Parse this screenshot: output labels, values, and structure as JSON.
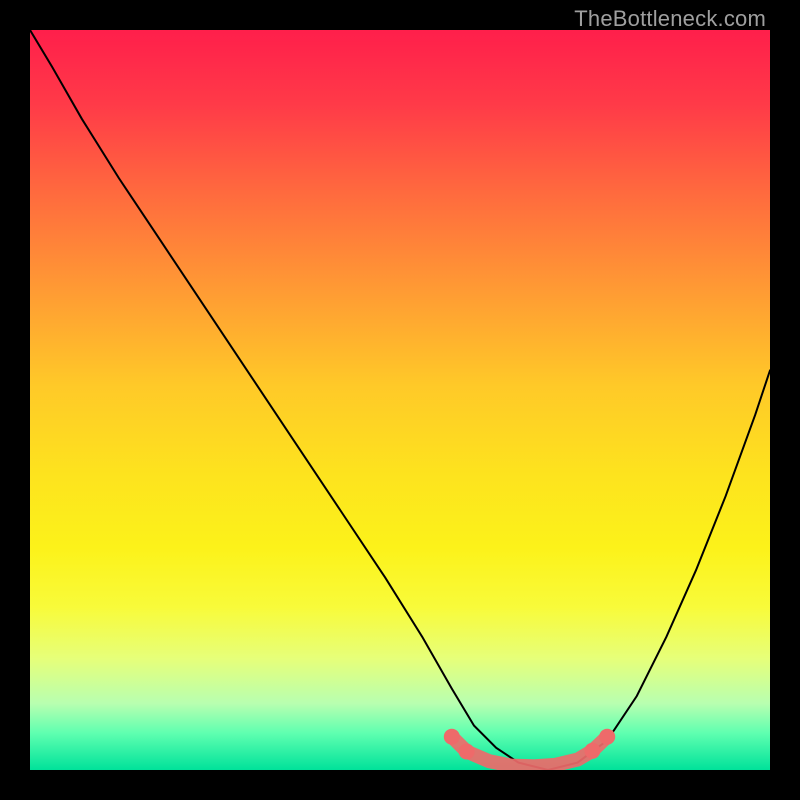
{
  "watermark": "TheBottleneck.com",
  "chart_data": {
    "type": "line",
    "title": "",
    "xlabel": "",
    "ylabel": "",
    "xlim": [
      0,
      100
    ],
    "ylim": [
      0,
      100
    ],
    "grid": false,
    "series": [
      {
        "name": "bottleneck-curve",
        "color": "#000000",
        "x": [
          0,
          3,
          7,
          12,
          18,
          24,
          30,
          36,
          42,
          48,
          53,
          57,
          60,
          63,
          66,
          70,
          74,
          78,
          82,
          86,
          90,
          94,
          98,
          100
        ],
        "y": [
          100,
          95,
          88,
          80,
          71,
          62,
          53,
          44,
          35,
          26,
          18,
          11,
          6,
          3,
          1,
          0,
          1,
          4,
          10,
          18,
          27,
          37,
          48,
          54
        ]
      },
      {
        "name": "optimal-range-marker",
        "color": "#ee6a6a",
        "x": [
          57,
          59,
          62,
          65,
          68,
          71,
          74,
          76,
          78
        ],
        "y": [
          4.5,
          2.5,
          1.2,
          0.6,
          0.5,
          0.7,
          1.4,
          2.6,
          4.5
        ]
      }
    ],
    "background_gradient": {
      "stops": [
        {
          "pct": 0,
          "color": "#ff1f4b"
        },
        {
          "pct": 35,
          "color": "#ff9a34"
        },
        {
          "pct": 60,
          "color": "#fde31e"
        },
        {
          "pct": 85,
          "color": "#e6ff7a"
        },
        {
          "pct": 100,
          "color": "#00e29a"
        }
      ]
    }
  }
}
